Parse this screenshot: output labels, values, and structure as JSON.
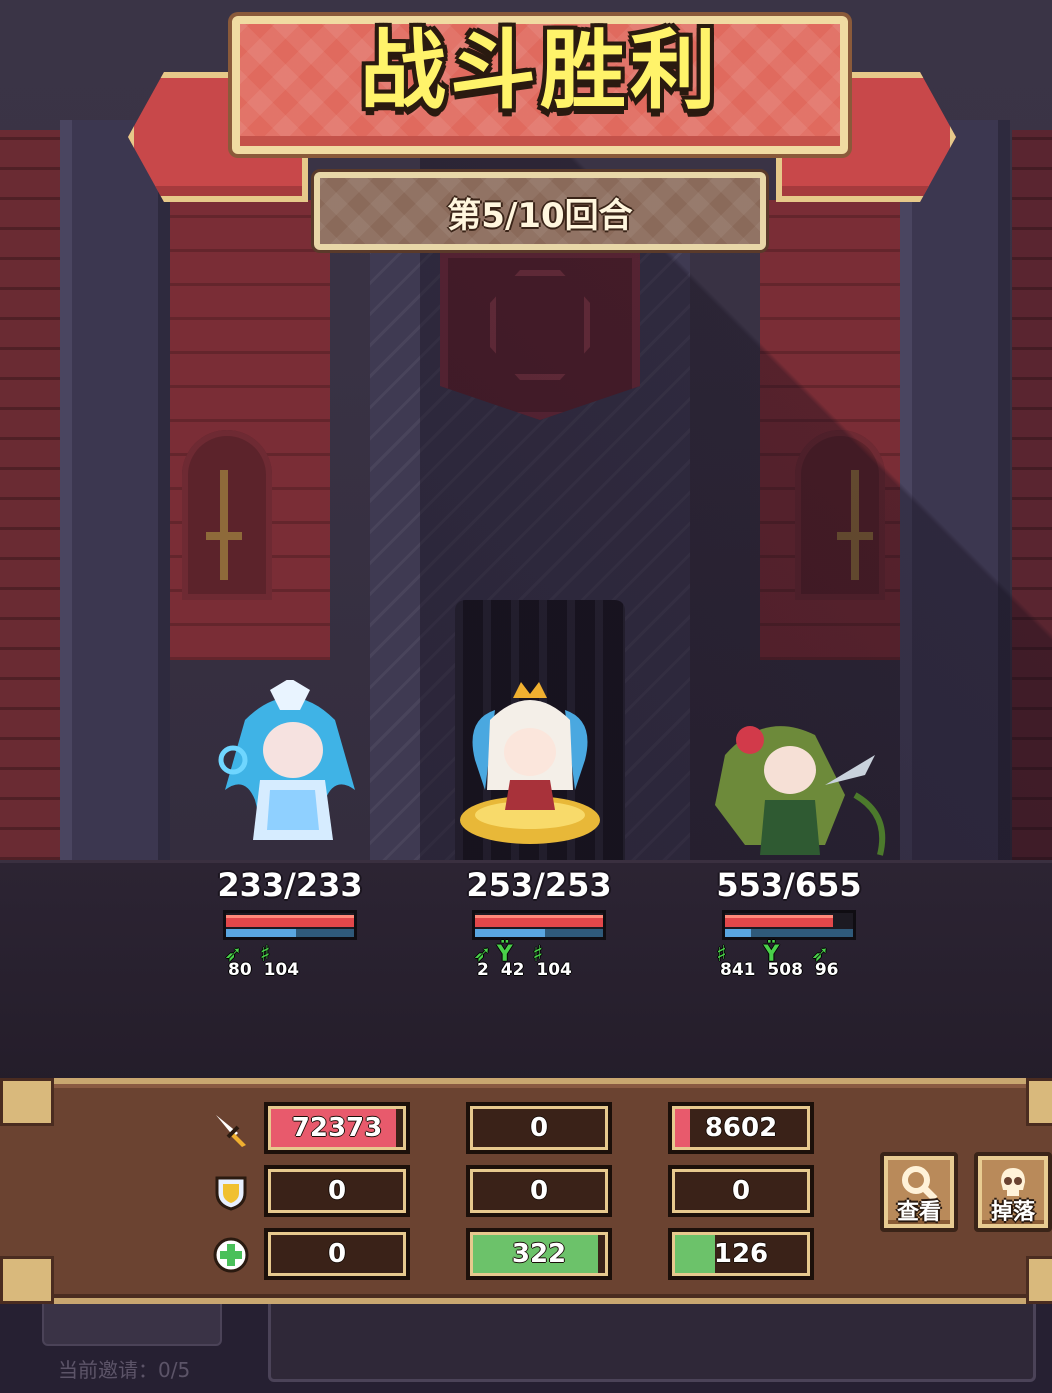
{
  "header": {
    "title": "战斗胜利",
    "round": "第5/10回合"
  },
  "heroes": [
    {
      "name_tag": "ice-priestess",
      "hp": "233/233",
      "hp_fraction": 1.0,
      "mp_fraction": 0.55,
      "stats": [
        "80",
        "104"
      ]
    },
    {
      "name_tag": "golden-queen",
      "hp": "253/253",
      "hp_fraction": 1.0,
      "mp_fraction": 0.55,
      "stats": [
        "2",
        "42",
        "104"
      ]
    },
    {
      "name_tag": "rose-dryad",
      "hp": "553/655",
      "hp_fraction": 0.84,
      "mp_fraction": 0.2,
      "stats": [
        "841",
        "508",
        "96"
      ]
    }
  ],
  "damage_panel": {
    "row_icons": [
      "sword-icon",
      "shield-icon",
      "heal-cross-icon"
    ],
    "columns": [
      {
        "damage": "72373",
        "damage_fill": 0.95,
        "taken": "0",
        "heal": "0",
        "heal_fill": 0
      },
      {
        "damage": "0",
        "damage_fill": 0,
        "taken": "0",
        "heal": "322",
        "heal_fill": 0.95
      },
      {
        "damage": "8602",
        "damage_fill": 0.11,
        "taken": "0",
        "heal": "126",
        "heal_fill": 0.3
      }
    ],
    "colors": {
      "damage": "#e85a6c",
      "heal": "#6cc26a"
    },
    "buttons": {
      "view": "查看",
      "drop": "掉落"
    }
  },
  "invite": {
    "status": "当前邀请：0/5"
  }
}
